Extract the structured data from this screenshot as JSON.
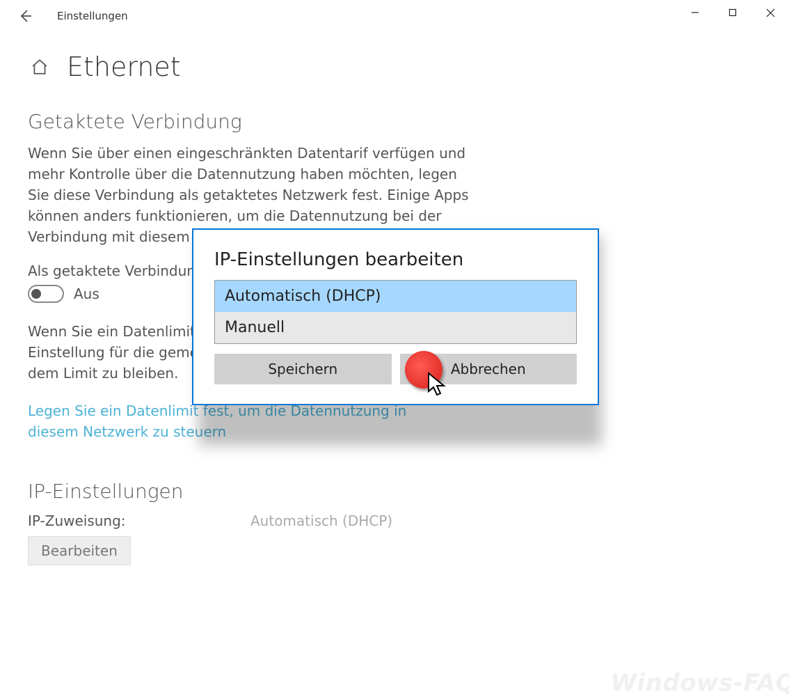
{
  "window": {
    "app_title": "Einstellungen"
  },
  "page": {
    "title": "Ethernet"
  },
  "metered": {
    "heading": "Getaktete Verbindung",
    "description": "Wenn Sie über einen eingeschränkten Datentarif verfügen und mehr Kontrolle über die Datennutzung haben möchten, legen Sie diese Verbindung als getaktetes Netzwerk fest. Einige Apps können anders funktionieren, um die Datennutzung bei der Verbindung mit diesem Netzwerk zu reduzieren.",
    "toggle_label": "Als getaktete Verbindung festlegen",
    "toggle_state": "Aus",
    "limit_text": "Wenn Sie ein Datenlimit festlegen, wird Windows die Einstellung für die gemessene Verbindung festlegen, um unter dem Limit zu bleiben.",
    "limit_link": "Legen Sie ein Datenlimit fest, um die Datennutzung in diesem Netzwerk zu steuern"
  },
  "ip": {
    "heading": "IP-Einstellungen",
    "assignment_label": "IP-Zuweisung:",
    "assignment_value": "Automatisch (DHCP)",
    "edit_label": "Bearbeiten"
  },
  "dialog": {
    "title": "IP-Einstellungen bearbeiten",
    "option_auto": "Automatisch (DHCP)",
    "option_manual": "Manuell",
    "save": "Speichern",
    "cancel": "Abbrechen"
  },
  "watermark": "Windows-FAQ"
}
